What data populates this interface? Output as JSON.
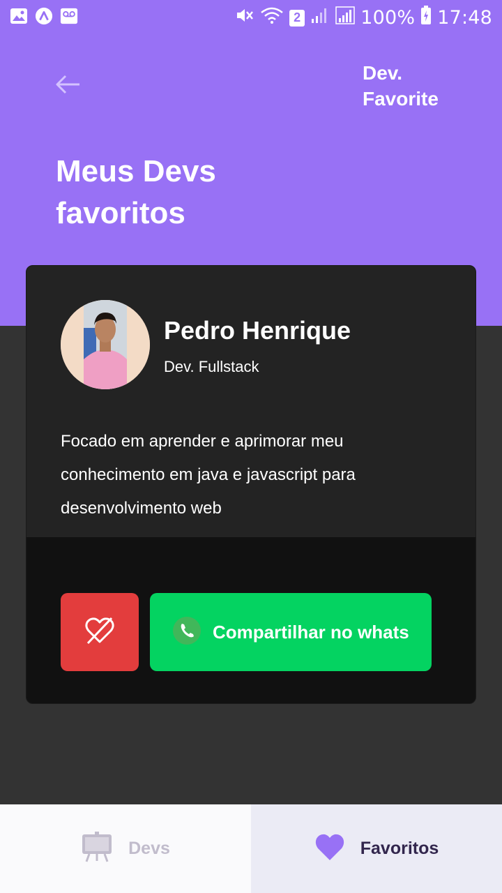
{
  "status_bar": {
    "battery": "100%",
    "time": "17:48",
    "sim_badge": "2",
    "icons": [
      "image-icon",
      "app-a-icon",
      "voicemail-icon",
      "mute-icon",
      "wifi-icon",
      "signal-icon",
      "signal-icon",
      "battery-charging-icon"
    ]
  },
  "header": {
    "back_icon": "arrow-left-icon",
    "brand": "Dev. Favorite",
    "title": "Meus Devs favoritos"
  },
  "card": {
    "name": "Pedro Henrique",
    "role": "Dev. Fullstack",
    "bio": "Focado em aprender e aprimorar meu conhecimento em java e javascript para desenvolvimento web",
    "unfavorite_icon": "heart-off-icon",
    "whatsapp_icon": "whatsapp-icon",
    "whatsapp_label": "Compartilhar no whats"
  },
  "tabbar": {
    "devs_label": "Devs",
    "devs_icon": "easel-icon",
    "favorites_label": "Favoritos",
    "favorites_icon": "heart-icon",
    "active_tab": "Favoritos"
  },
  "colors": {
    "primary": "#9871f5",
    "background": "#333333",
    "card": "#232323",
    "card_footer": "#111111",
    "danger": "#e33d3d",
    "whatsapp": "#04d361"
  }
}
